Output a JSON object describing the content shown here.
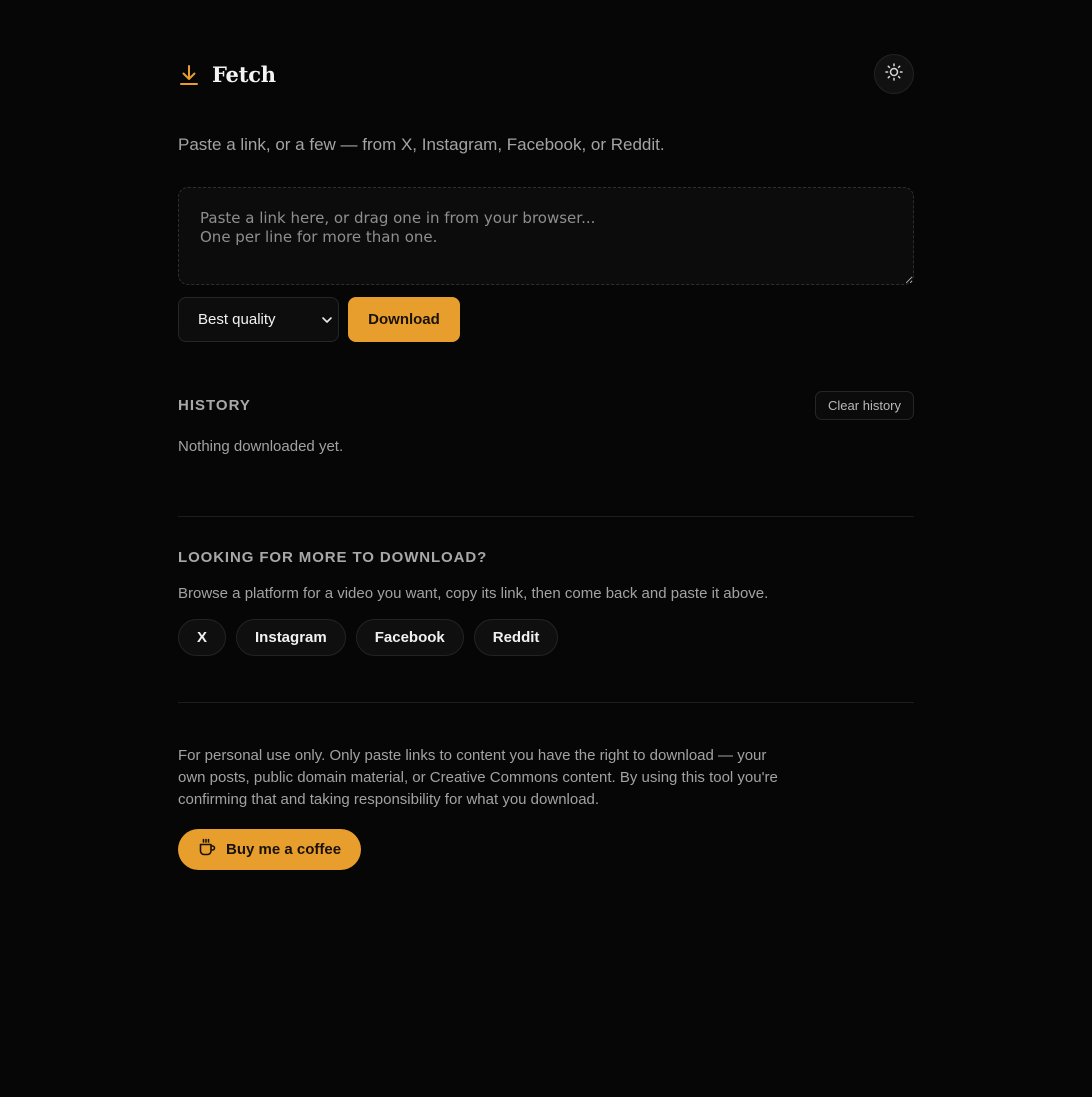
{
  "app": {
    "title": "Fetch",
    "accent_color": "#e89e2d",
    "icons": {
      "logo": "download-arrow-icon",
      "theme": "sun-icon",
      "select": "chevron-down-icon",
      "coffee": "coffee-cup-icon"
    }
  },
  "main": {
    "tagline": "Paste a link, or a few — from X, Instagram, Facebook, or Reddit.",
    "input_placeholder": "Paste a link here, or drag one in from your browser...\nOne per line for more than one.",
    "input_value": "",
    "quality_select": {
      "selected": "Best quality"
    },
    "download_label": "Download"
  },
  "history": {
    "heading": "HISTORY",
    "clear_label": "Clear history",
    "empty_text": "Nothing downloaded yet."
  },
  "more": {
    "heading": "LOOKING FOR MORE TO DOWNLOAD?",
    "description": "Browse a platform for a video you want, copy its link, then come back and paste it above.",
    "platforms": [
      "X",
      "Instagram",
      "Facebook",
      "Reddit"
    ]
  },
  "footer": {
    "disclaimer": "For personal use only. Only paste links to content you have the right to download — your own posts, public domain material, or Creative Commons content. By using this tool you're confirming that and taking responsibility for what you download.",
    "coffee_label": "Buy me a coffee"
  }
}
